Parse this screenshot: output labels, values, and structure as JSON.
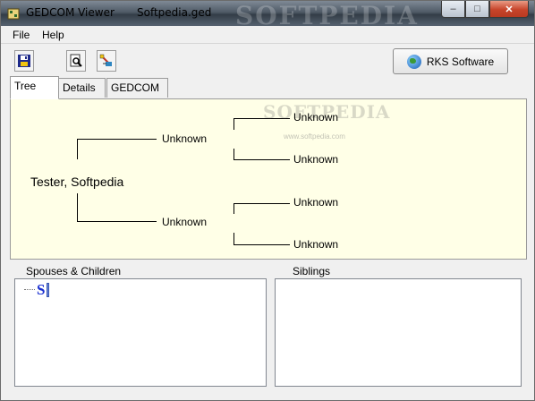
{
  "window": {
    "app_title": "GEDCOM Viewer",
    "file_title": "Softpedia.ged",
    "title_watermark": "SOFTPEDIA",
    "controls": {
      "minimize": "–",
      "maximize": "□",
      "close": "✕"
    }
  },
  "menu": {
    "file": "File",
    "help": "Help"
  },
  "toolbar": {
    "icons": [
      "save-icon",
      "preview-icon",
      "tools-icon"
    ],
    "rks_button": "RKS Software"
  },
  "tabs": [
    {
      "label": "Tree",
      "active": true
    },
    {
      "label": "Details",
      "active": false
    },
    {
      "label": "GEDCOM",
      "active": false
    }
  ],
  "tree": {
    "root": "Tester, Softpedia",
    "father": "Unknown",
    "mother": "Unknown",
    "paternal_grandfather": "Unknown",
    "paternal_grandmother": "Unknown",
    "maternal_grandfather": "Unknown",
    "maternal_grandmother": "Unknown",
    "watermark": "SOFTPEDIA",
    "watermark_url": "www.softpedia.com"
  },
  "panels": {
    "spouses_label": "Spouses & Children",
    "siblings_label": "Siblings",
    "spouses_item": "S"
  },
  "colors": {
    "tree_background": "#ffffe7",
    "accent_blue": "#1a2fd0"
  }
}
